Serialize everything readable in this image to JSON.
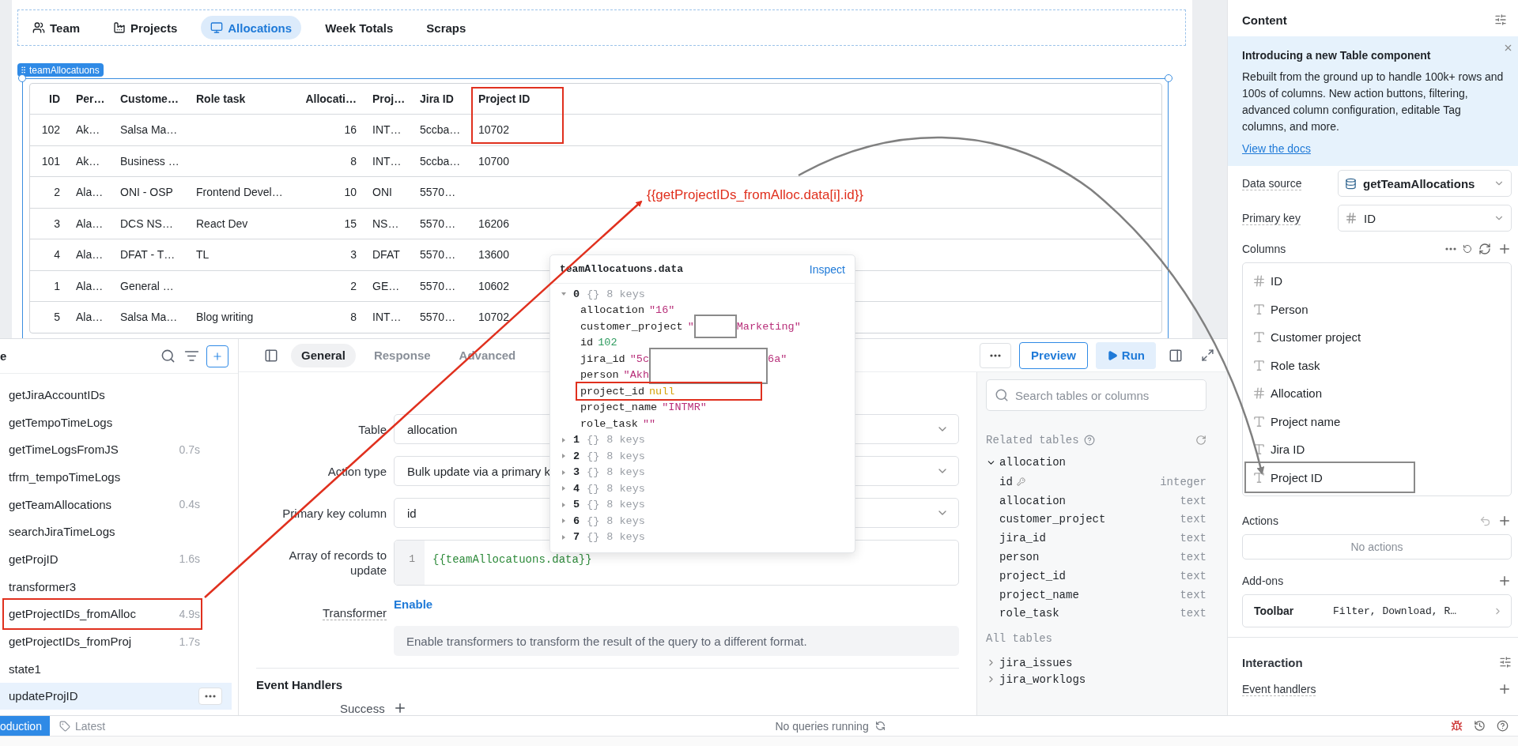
{
  "canvas": {
    "tabs": [
      {
        "label": "Team",
        "selected": false
      },
      {
        "label": "Projects",
        "selected": false
      },
      {
        "label": "Allocations",
        "selected": true
      },
      {
        "label": "Week Totals",
        "selected": false
      },
      {
        "label": "Scraps",
        "selected": false
      }
    ],
    "component_label": "teamAllocatuons",
    "table": {
      "columns": [
        {
          "label": "ID",
          "kind": "number",
          "highlighted": false
        },
        {
          "label": "Per…",
          "kind": "text",
          "highlighted": false
        },
        {
          "label": "Custome…",
          "kind": "text",
          "highlighted": false
        },
        {
          "label": "Role task",
          "kind": "text",
          "highlighted": false
        },
        {
          "label": "Allocati…",
          "kind": "number",
          "highlighted": false
        },
        {
          "label": "Proj…",
          "kind": "text",
          "highlighted": false
        },
        {
          "label": "Jira ID",
          "kind": "text",
          "highlighted": false
        },
        {
          "label": "Project ID",
          "kind": "text",
          "highlighted": true
        }
      ],
      "rows": [
        {
          "cells": [
            "102",
            "Ak…",
            "Salsa Ma…",
            null,
            "16",
            "INT…",
            "5ccba…",
            "10702"
          ]
        },
        {
          "cells": [
            "101",
            "Ak…",
            "Business …",
            null,
            "8",
            "INT…",
            "5ccba…",
            "10700"
          ]
        },
        {
          "cells": [
            "2",
            "Ala…",
            "ONI - OSP",
            "Frontend Devel…",
            "10",
            "ONI",
            "5570…",
            null
          ]
        },
        {
          "cells": [
            "3",
            "Ala…",
            "DCS NS…",
            "React Dev",
            "15",
            "NS…",
            "5570…",
            "16206"
          ]
        },
        {
          "cells": [
            "4",
            "Ala…",
            "DFAT - T…",
            "TL",
            "3",
            "DFAT",
            "5570…",
            "13600"
          ]
        },
        {
          "cells": [
            "1",
            "Ala…",
            "General …",
            null,
            "2",
            "GE…",
            "5570…",
            "10602"
          ]
        },
        {
          "cells": [
            "5",
            "Ala…",
            "Salsa Ma…",
            "Blog writing",
            "8",
            "INT…",
            "5570…",
            "10702"
          ]
        }
      ]
    }
  },
  "annotation": {
    "text": "{{getProjectIDs_fromAlloc.data[i].id}}"
  },
  "inspector": {
    "title": "teamAllocatuons.data",
    "action": "Inspect",
    "items": [
      {
        "index": "0",
        "summary": "{}",
        "count": "8 keys",
        "expanded": true,
        "fields": [
          {
            "key": "allocation",
            "kind": "string",
            "value": "\"16\"",
            "redacted": false,
            "highlighted": false
          },
          {
            "key": "customer_project",
            "kind": "string",
            "value": "\"",
            "redacted": true,
            "value_tail": "Marketing\"",
            "highlighted": false
          },
          {
            "key": "id",
            "kind": "number",
            "value": "102",
            "redacted": false,
            "highlighted": false
          },
          {
            "key": "jira_id",
            "kind": "string",
            "value": "\"5c",
            "redacted": true,
            "value_tail": "6a\"",
            "highlighted": false
          },
          {
            "key": "person",
            "kind": "string",
            "value": "\"Akh",
            "redacted": false,
            "highlighted": false
          },
          {
            "key": "project_id",
            "kind": "null",
            "value": "null",
            "redacted": false,
            "highlighted": true
          },
          {
            "key": "project_name",
            "kind": "string",
            "value": "\"INTMR\"",
            "redacted": false,
            "highlighted": false
          },
          {
            "key": "role_task",
            "kind": "string",
            "value": "\"\"",
            "redacted": false,
            "highlighted": false
          }
        ]
      },
      {
        "index": "1",
        "summary": "{}",
        "count": "8 keys",
        "expanded": false
      },
      {
        "index": "2",
        "summary": "{}",
        "count": "8 keys",
        "expanded": false
      },
      {
        "index": "3",
        "summary": "{}",
        "count": "8 keys",
        "expanded": false
      },
      {
        "index": "4",
        "summary": "{}",
        "count": "8 keys",
        "expanded": false
      },
      {
        "index": "5",
        "summary": "{}",
        "count": "8 keys",
        "expanded": false
      },
      {
        "index": "6",
        "summary": "{}",
        "count": "8 keys",
        "expanded": false
      },
      {
        "index": "7",
        "summary": "{}",
        "count": "8 keys",
        "expanded": false
      }
    ]
  },
  "queries": {
    "title": "e",
    "items": [
      {
        "name": "getJiraAccountIDs",
        "selected": false,
        "highlighted": false
      },
      {
        "name": "getTempoTimeLogs",
        "selected": false,
        "highlighted": false
      },
      {
        "name": "getTimeLogsFromJS",
        "time": "0.7s",
        "selected": false,
        "highlighted": false
      },
      {
        "name": "tfrm_tempoTimeLogs",
        "selected": false,
        "highlighted": false
      },
      {
        "name": "getTeamAllocations",
        "time": "0.4s",
        "selected": false,
        "highlighted": false
      },
      {
        "name": "searchJiraTimeLogs",
        "selected": false,
        "highlighted": false
      },
      {
        "name": "getProjID",
        "time": "1.6s",
        "selected": false,
        "highlighted": false
      },
      {
        "name": "transformer3",
        "selected": false,
        "highlighted": false
      },
      {
        "name": "getProjectIDs_fromAlloc",
        "time": "4.9s",
        "selected": false,
        "highlighted": true
      },
      {
        "name": "getProjectIDs_fromProj",
        "time": "1.7s",
        "selected": false,
        "highlighted": false
      },
      {
        "name": "state1",
        "selected": false,
        "highlighted": false
      },
      {
        "name": "updateProjID",
        "selected": true,
        "highlighted": false
      }
    ]
  },
  "editor": {
    "tabs": [
      {
        "label": "General",
        "selected": true
      },
      {
        "label": "Response",
        "selected": false
      },
      {
        "label": "Advanced",
        "selected": false
      }
    ],
    "preview": "Preview",
    "run": "Run",
    "fields": [
      {
        "label": "Table",
        "kind": "select",
        "value": "allocation"
      },
      {
        "label": "Action type",
        "kind": "select",
        "value": "Bulk update via a primary k"
      },
      {
        "label": "Primary key column",
        "kind": "select",
        "value": "id"
      },
      {
        "label": "Array of records to update",
        "kind": "code",
        "line_number": "1",
        "value": "{{teamAllocatuons.data}}"
      },
      {
        "label": "Transformer",
        "kind": "link",
        "value": "Enable",
        "note": "Enable transformers to transform the result of the query to a different format."
      }
    ],
    "event_handlers": {
      "title": "Event Handlers",
      "success": "Success"
    }
  },
  "schema": {
    "search_placeholder": "Search tables or columns",
    "related_title": "Related tables",
    "tables": [
      {
        "name": "allocation",
        "expanded": true,
        "columns": [
          {
            "name": "id",
            "type": "integer",
            "primary_key": true
          },
          {
            "name": "allocation",
            "type": "text",
            "primary_key": false
          },
          {
            "name": "customer_project",
            "type": "text",
            "primary_key": false
          },
          {
            "name": "jira_id",
            "type": "text",
            "primary_key": false
          },
          {
            "name": "person",
            "type": "text",
            "primary_key": false
          },
          {
            "name": "project_id",
            "type": "text",
            "primary_key": false
          },
          {
            "name": "project_name",
            "type": "text",
            "primary_key": false
          },
          {
            "name": "role_task",
            "type": "text",
            "primary_key": false
          }
        ]
      }
    ],
    "all_title": "All tables",
    "all_tables": [
      {
        "name": "jira_issues"
      },
      {
        "name": "jira_worklogs"
      }
    ]
  },
  "inspector_panel": {
    "content_title": "Content",
    "banner": {
      "title": "Introducing a new Table component",
      "body": "Rebuilt from the ground up to handle 100k+ rows and 100s of columns. New action buttons, filtering, advanced column configuration, editable Tag columns, and more.",
      "link": "View the docs"
    },
    "data_source": {
      "label": "Data source",
      "value": "getTeamAllocations"
    },
    "primary_key": {
      "label": "Primary key",
      "value": "ID"
    },
    "columns": {
      "label": "Columns",
      "items": [
        {
          "name": "ID",
          "kind": "number",
          "highlighted": false
        },
        {
          "name": "Person",
          "kind": "text",
          "highlighted": false
        },
        {
          "name": "Customer project",
          "kind": "text",
          "highlighted": false
        },
        {
          "name": "Role task",
          "kind": "text",
          "highlighted": false
        },
        {
          "name": "Allocation",
          "kind": "number",
          "highlighted": false
        },
        {
          "name": "Project name",
          "kind": "text",
          "highlighted": false
        },
        {
          "name": "Jira ID",
          "kind": "text",
          "highlighted": false
        },
        {
          "name": "Project ID",
          "kind": "text",
          "highlighted": true
        }
      ]
    },
    "actions": {
      "label": "Actions",
      "empty": "No actions"
    },
    "addons": {
      "label": "Add-ons",
      "items": [
        {
          "name": "Toolbar",
          "value": "Filter, Download, R…"
        }
      ]
    },
    "interaction": {
      "title": "Interaction",
      "event_handlers": "Event handlers"
    }
  },
  "status_bar": {
    "environment": "oduction",
    "version": "Latest",
    "queries": "No queries running"
  }
}
